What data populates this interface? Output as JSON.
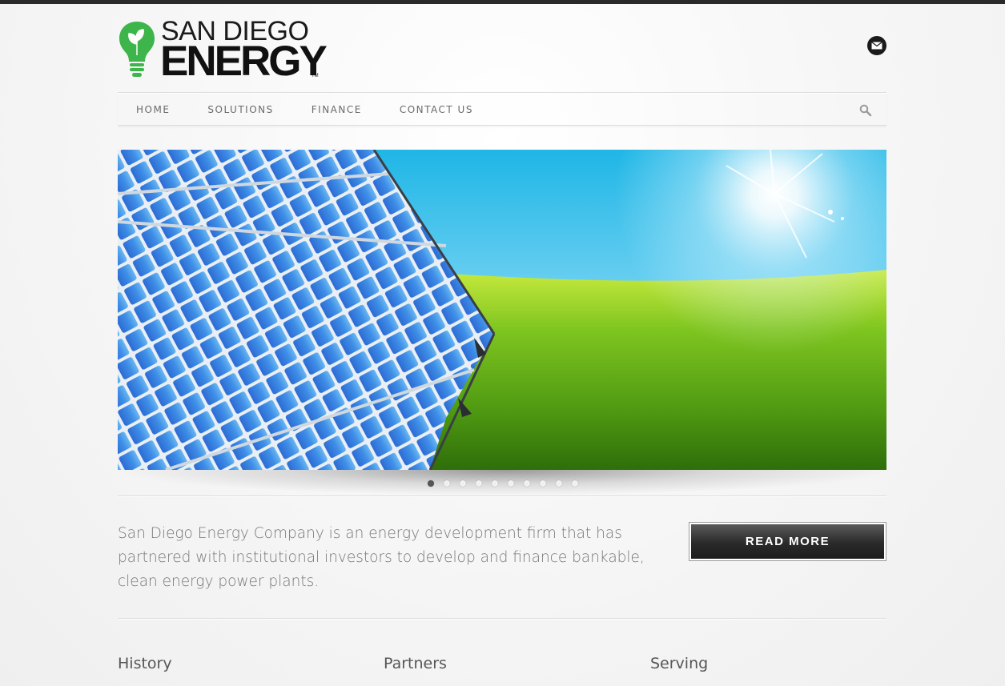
{
  "brand": {
    "line1": "SAN DIEGO",
    "line2": "ENERGY",
    "trademark": "TM",
    "accent": "#3db54a"
  },
  "header": {
    "mail_icon": "mail-icon"
  },
  "nav": {
    "items": [
      "HOME",
      "SOLUTIONS",
      "FINANCE",
      "CONTACT US"
    ],
    "search_icon": "search-icon"
  },
  "slider": {
    "slide_count": 10,
    "active_index": 0
  },
  "intro": {
    "text": "San Diego Energy Company is an energy development firm that has partnered with institutional investors to develop and finance bankable, clean energy power plants.",
    "button_label": "READ MORE"
  },
  "columns": [
    "History",
    "Partners",
    "Serving"
  ]
}
